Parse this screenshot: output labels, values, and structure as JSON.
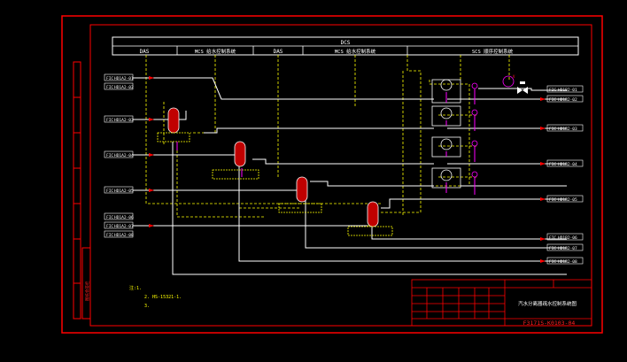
{
  "colors": {
    "background": "#000000",
    "frame": "#ff0000",
    "line": "#ffffff",
    "dashed": "#ffff00",
    "process": "#ff00ff",
    "equipment": "#ff0000",
    "tag_text": "#ff2020"
  },
  "bus": {
    "title": "DCS",
    "sections": [
      "DAS",
      "MCS 给水控制系统",
      "DAS",
      "MCS 给水控制系统",
      "SCS 顺序控制系统"
    ]
  },
  "left_tags": [
    {
      "code": "FIC",
      "tag": "HD1A2-01"
    },
    {
      "code": "FIC",
      "tag": "HD1A2-02"
    },
    {
      "code": "FIC",
      "tag": "HD1A2-03"
    },
    {
      "code": "FIC",
      "tag": "HD1A2-04"
    },
    {
      "code": "FIC",
      "tag": "HD1A2-05"
    },
    {
      "code": "FIC",
      "tag": "HD1A2-06"
    },
    {
      "code": "FIC",
      "tag": "HD1A2-07"
    },
    {
      "code": "FIC",
      "tag": "HD1A2-08"
    }
  ],
  "right_tags": [
    {
      "code": "FIC",
      "tag": "HD1B2-01"
    },
    {
      "code": "FIC",
      "tag": "HD1B2-02"
    },
    {
      "code": "FIC",
      "tag": "HD1B2-03"
    },
    {
      "code": "FIC",
      "tag": "HD1B2-04"
    },
    {
      "code": "FIC",
      "tag": "HD1B2-05"
    },
    {
      "code": "FIC",
      "tag": "HD1B2-06"
    },
    {
      "code": "FIC",
      "tag": "HD1B2-07"
    },
    {
      "code": "FIC",
      "tag": "HD1B2-08"
    }
  ],
  "notes": {
    "line1": "注:1.",
    "line2": "2. HS-15321-1.",
    "line3": "3."
  },
  "title_block": {
    "drawing_title": "汽水分离器疏水控制系统图",
    "drawing_no": "F3171S-K0103-04",
    "side_label": "图纸会签栏"
  }
}
